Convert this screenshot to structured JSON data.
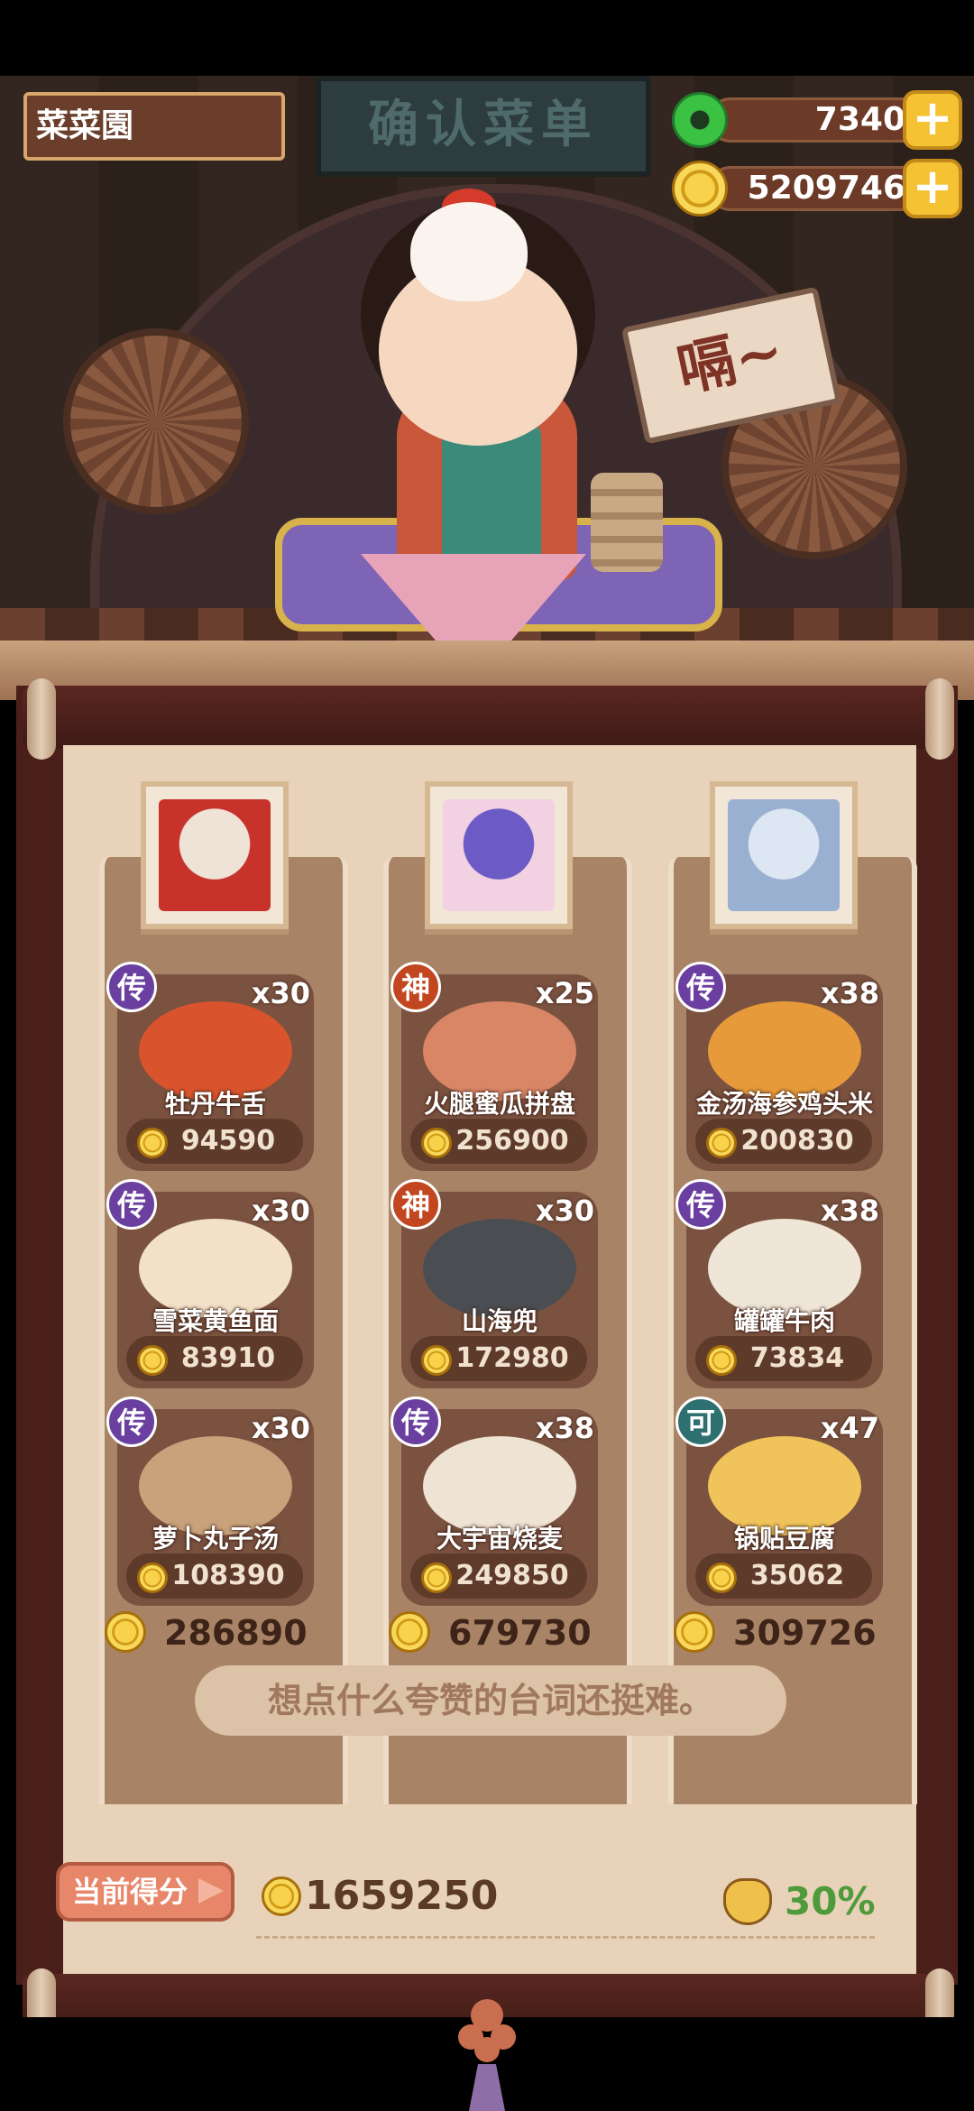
{
  "header": {
    "restaurant_name": "菜菜園",
    "sign_text": "确认菜单",
    "jade_amount": "7340",
    "coin_amount": "5209746",
    "speech_bubble": "嗝~"
  },
  "columns": [
    {
      "dishes": [
        {
          "tier": "传",
          "qty": "x30",
          "name": "牡丹牛舌",
          "price": "94590",
          "food_color": "#d9542d"
        },
        {
          "tier": "传",
          "qty": "x30",
          "name": "雪菜黄鱼面",
          "price": "83910",
          "food_color": "#f2e1c8"
        },
        {
          "tier": "传",
          "qty": "x30",
          "name": "萝卜丸子汤",
          "price": "108390",
          "food_color": "#c7a27b"
        }
      ],
      "total": "286890"
    },
    {
      "dishes": [
        {
          "tier": "神",
          "qty": "x25",
          "name": "火腿蜜瓜拼盘",
          "price": "256900",
          "food_color": "#d98666"
        },
        {
          "tier": "神",
          "qty": "x30",
          "name": "山海兜",
          "price": "172980",
          "food_color": "#4a4d52"
        },
        {
          "tier": "传",
          "qty": "x38",
          "name": "大宇宙烧麦",
          "price": "249850",
          "food_color": "#efe3d3"
        }
      ],
      "total": "679730"
    },
    {
      "dishes": [
        {
          "tier": "传",
          "qty": "x38",
          "name": "金汤海参鸡头米",
          "price": "200830",
          "food_color": "#e69a3a"
        },
        {
          "tier": "传",
          "qty": "x38",
          "name": "罐罐牛肉",
          "price": "73834",
          "food_color": "#efe6d8"
        },
        {
          "tier": "可",
          "qty": "x47",
          "name": "锅贴豆腐",
          "price": "35062",
          "food_color": "#f0c45a"
        }
      ],
      "total": "309726"
    }
  ],
  "quote": "想点什么夸赞的台词还挺难。",
  "score": {
    "button_label": "当前得分",
    "value": "1659250",
    "bonus": "30%"
  },
  "colors": {
    "chuan": "#6a3fa0",
    "shen": "#c2461f",
    "ke": "#2e6f70",
    "bonus_green": "#4f9a3b"
  },
  "icons": [
    "jade-icon",
    "coin-icon",
    "plus-icon",
    "money-bag-icon",
    "arrow-right-icon"
  ]
}
